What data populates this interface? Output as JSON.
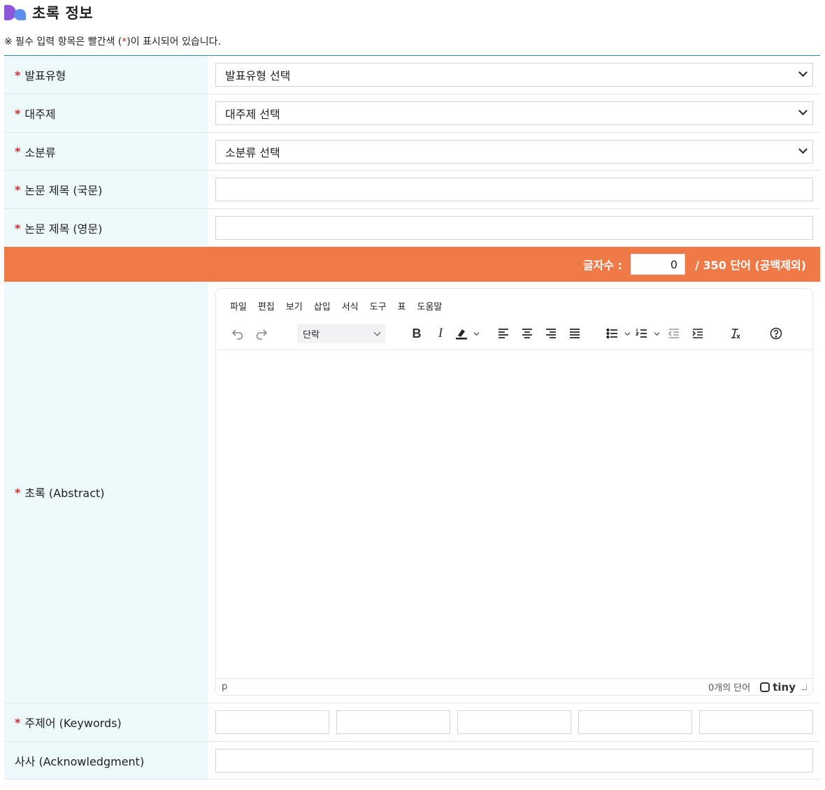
{
  "header": {
    "title": "초록 정보",
    "logo": "presentation-logo-icon"
  },
  "notice": {
    "prefix": "※ 필수 입력 항목은 빨간색 (",
    "star": "*",
    "suffix": ")이 표시되어 있습니다."
  },
  "colors": {
    "accent_bar": "#ef7a48",
    "label_bg": "#eef9fc",
    "required": "#d62a2a",
    "top_rule": "#1f8fa8"
  },
  "fields": {
    "presentation_type": {
      "label": "발표유형",
      "value": "발표유형 선택"
    },
    "main_topic": {
      "label": "대주제",
      "value": "대주제 선택"
    },
    "subcategory": {
      "label": "소분류",
      "value": "소분류 선택"
    },
    "title_kr": {
      "label": "논문 제목 (국문)",
      "value": ""
    },
    "title_en": {
      "label": "논문 제목 (영문)",
      "value": ""
    },
    "abstract": {
      "label": "초록 (Abstract)"
    },
    "keywords": {
      "label": "주제어 (Keywords)",
      "values": [
        "",
        "",
        "",
        "",
        ""
      ]
    },
    "acknowledgment": {
      "label": "사사 (Acknowledgment)",
      "value": ""
    },
    "required_mark": "*"
  },
  "word_count": {
    "label": "글자수 :",
    "value": "0",
    "limit": "/ 350 단어 (공백제외)"
  },
  "editor": {
    "menus": [
      "파일",
      "편집",
      "보기",
      "삽입",
      "서식",
      "도구",
      "표",
      "도움말"
    ],
    "block_format": "단락",
    "status_path": "p",
    "status_words": "0개의 단어",
    "brand": "tiny"
  }
}
